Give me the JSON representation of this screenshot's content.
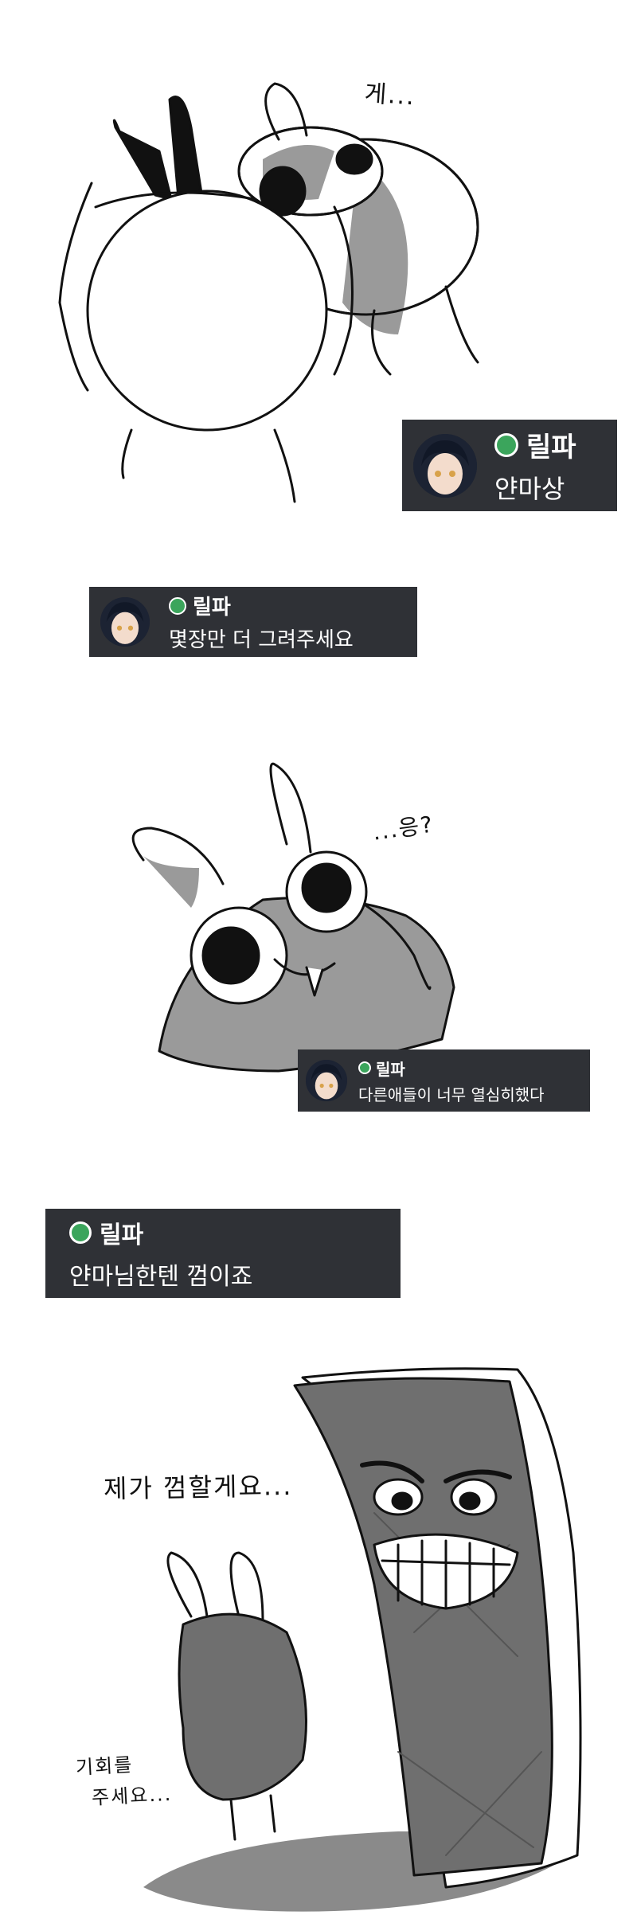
{
  "colors": {
    "card_bg": "#2f3136",
    "status_online": "#3ba55c",
    "text": "#ffffff",
    "shade": "#9a9a9a",
    "dark_shade": "#6f6f6f"
  },
  "sfx": {
    "panel1": "게...",
    "panel3": "...응?",
    "panel5_line1": "제가 껌할게요...",
    "panel5_line2a": "기회를",
    "panel5_line2b": "주세요..."
  },
  "messages": [
    {
      "username": "릴파",
      "text": "얀마상",
      "status": "online",
      "avatar": "avatar-icon"
    },
    {
      "username": "릴파",
      "text": "몇장만 더 그려주세요",
      "status": "online",
      "avatar": "avatar-icon"
    },
    {
      "username": "릴파",
      "text": "다른애들이 너무 열심히했다",
      "status": "online",
      "avatar": "avatar-icon"
    },
    {
      "username": "릴파",
      "text": "얀마님한텐 껌이죠",
      "status": "online"
    }
  ]
}
